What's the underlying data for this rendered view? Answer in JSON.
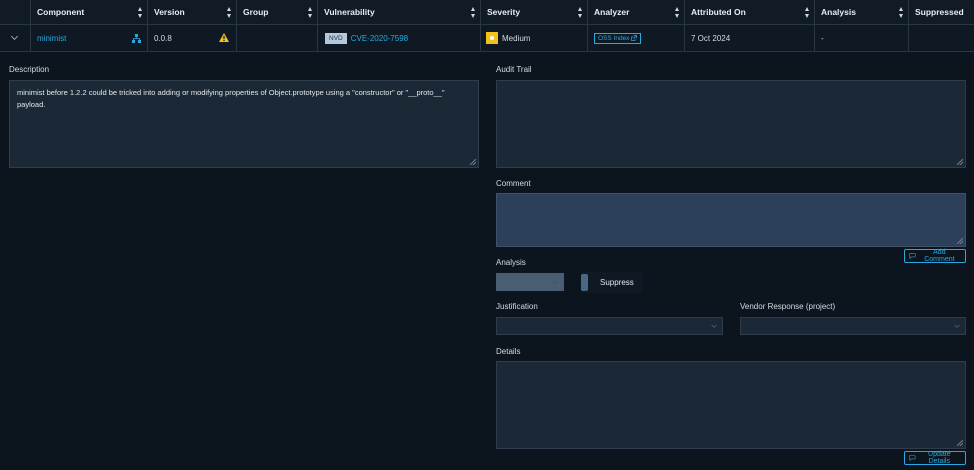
{
  "table": {
    "headers": {
      "component": "Component",
      "version": "Version",
      "group": "Group",
      "vulnerability": "Vulnerability",
      "severity": "Severity",
      "analyzer": "Analyzer",
      "attributed_on": "Attributed On",
      "analysis": "Analysis",
      "suppressed": "Suppressed"
    },
    "row": {
      "component": "minimist",
      "version": "0.0.8",
      "group": "",
      "vuln_source": "NVD",
      "vuln_id": "CVE-2020-7598",
      "severity": "Medium",
      "analyzer": "OSS Index",
      "attributed_on": "7 Oct 2024",
      "analysis": "-",
      "suppressed": ""
    }
  },
  "details": {
    "description_label": "Description",
    "description_text": "minimist before 1.2.2 could be tricked into adding or modifying properties of Object.prototype using a \"constructor\" or \"__proto__\" payload.",
    "audit_trail_label": "Audit Trail",
    "comment_label": "Comment",
    "add_comment_label": "Add Comment",
    "analysis_label": "Analysis",
    "suppress_label": "Suppress",
    "justification_label": "Justification",
    "vendor_response_label": "Vendor Response (project)",
    "details_label": "Details",
    "update_details_label": "Update Details"
  },
  "colors": {
    "accent": "#29a9e0",
    "severity_medium": "#f1c21b",
    "background": "#0c141d"
  }
}
